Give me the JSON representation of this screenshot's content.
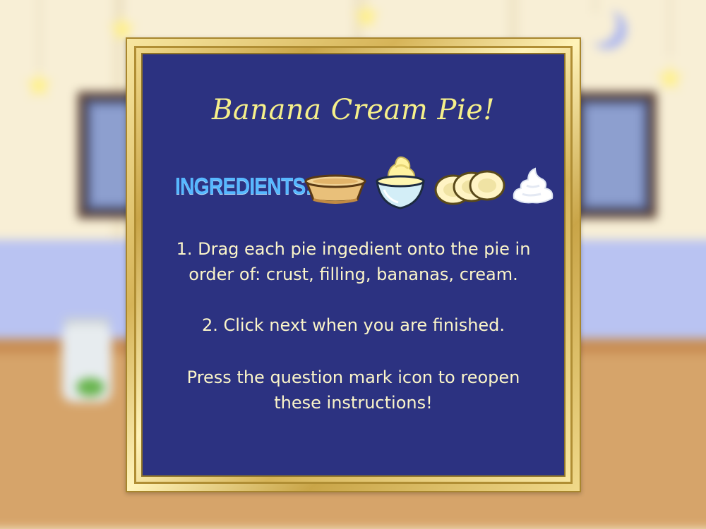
{
  "modal": {
    "title": "Banana Cream Pie!",
    "ingredients_label": "INGREDIENTS:",
    "ingredients": [
      {
        "icon": "pie-crust-icon",
        "name": "crust"
      },
      {
        "icon": "filling-bowl-icon",
        "name": "filling"
      },
      {
        "icon": "banana-slices-icon",
        "name": "bananas"
      },
      {
        "icon": "whipped-cream-icon",
        "name": "cream"
      }
    ],
    "steps": [
      "1. Drag each pie ingedient onto the pie in order of: crust, filling, bananas, cream.",
      "2. Click next when you are finished.",
      "Press the question mark icon to reopen these instructions!"
    ]
  },
  "colors": {
    "board": "#2c3281",
    "title": "#f6f08a",
    "ingredients_label": "#57b8ff",
    "body_text": "#fbf5c9",
    "frame_gold": "#d6b458"
  }
}
